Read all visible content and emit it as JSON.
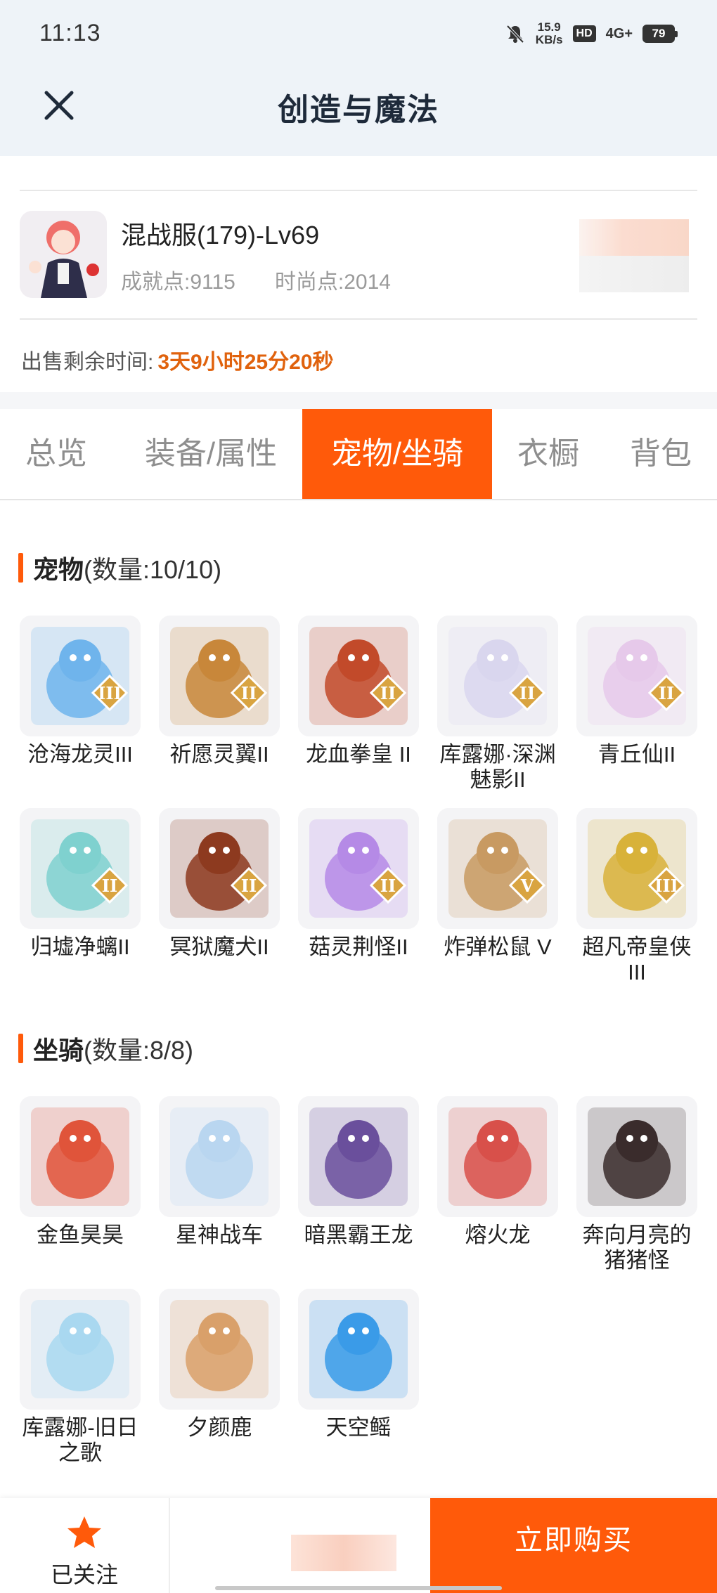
{
  "status_bar": {
    "time": "11:13",
    "net_speed_top": "15.9",
    "net_speed_unit": "KB/s",
    "hd": "HD",
    "network": "4G+",
    "battery": "79"
  },
  "header": {
    "title": "创造与魔法"
  },
  "character": {
    "name": "混战服(179)-Lv69",
    "achievement_points": "成就点:9115",
    "fashion_points": "时尚点:2014"
  },
  "sale": {
    "label": "出售剩余时间:",
    "remaining": "3天9小时25分20秒"
  },
  "tabs": [
    {
      "label": "总览"
    },
    {
      "label": "装备/属性"
    },
    {
      "label": "宠物/坐骑"
    },
    {
      "label": "衣橱"
    },
    {
      "label": "背包"
    }
  ],
  "active_tab": "宠物/坐骑",
  "pets": {
    "title": "宠物",
    "count": "(数量:10/10)",
    "items": [
      {
        "name": "沧海龙灵III",
        "tier": "III",
        "color": "#6fb4ec"
      },
      {
        "name": "祈愿灵翼II",
        "tier": "II",
        "color": "#c8873a"
      },
      {
        "name": "龙血拳皇 II",
        "tier": "II",
        "color": "#c24a2a"
      },
      {
        "name": "库露娜·深渊魅影II",
        "tier": "II",
        "color": "#d9d6ee"
      },
      {
        "name": "青丘仙II",
        "tier": "II",
        "color": "#e6c9ea"
      },
      {
        "name": "归墟净螭II",
        "tier": "II",
        "color": "#7fd1cf"
      },
      {
        "name": "冥狱魔犬II",
        "tier": "II",
        "color": "#8d3a1f"
      },
      {
        "name": "菇灵荆怪II",
        "tier": "II",
        "color": "#b58ae6"
      },
      {
        "name": "炸弹松鼠 V",
        "tier": "V",
        "color": "#c89a62"
      },
      {
        "name": "超凡帝皇侠III",
        "tier": "III",
        "color": "#d8b23a"
      }
    ]
  },
  "mounts": {
    "title": "坐骑",
    "count": "(数量:8/8)",
    "items": [
      {
        "name": "金鱼昊昊",
        "color": "#e0543a"
      },
      {
        "name": "星神战车",
        "color": "#b9d6f0"
      },
      {
        "name": "暗黑霸王龙",
        "color": "#6a4f9c"
      },
      {
        "name": "熔火龙",
        "color": "#d8504a"
      },
      {
        "name": "奔向月亮的猪猪怪",
        "color": "#3a2c2c"
      },
      {
        "name": "库露娜-旧日之歌",
        "color": "#a9d8f0"
      },
      {
        "name": "夕颜鹿",
        "color": "#d9a06a"
      },
      {
        "name": "天空鳐",
        "color": "#3a9be8"
      }
    ]
  },
  "bottom_bar": {
    "follow_label": "已关注",
    "buy_label": "立即购买"
  },
  "colors": {
    "accent": "#ff5a0a",
    "sale_time": "#e0620d"
  },
  "icons": {
    "close": "close-icon",
    "follow": "star-icon"
  }
}
